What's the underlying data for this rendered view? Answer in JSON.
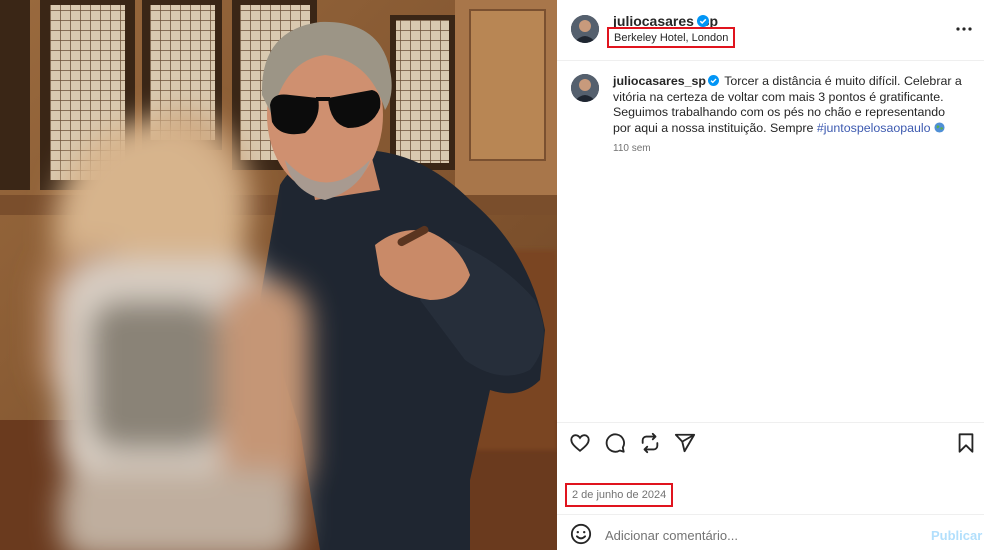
{
  "post": {
    "username": "juliocasares_sp",
    "verified_icon": "verified-badge-icon",
    "location": "Berkeley Hotel, London",
    "more_icon": "more-dots-icon",
    "caption": {
      "username": "juliocasares_sp",
      "text": "Torcer a distância é muito difícil. Celebrar a vitória na certeza de voltar com mais 3 pontos é gratificante. Seguimos trabalhando com os pés no chão e representando por aqui a nossa instituição. Sempre ",
      "hashtag": "#juntospelosaopaulo",
      "emoji": "globe-emoji"
    },
    "age": "110 sem",
    "actions": [
      "heart-icon",
      "comment-icon",
      "share-icon",
      "send-icon",
      "bookmark-icon"
    ],
    "date": "2 de junho de 2024",
    "comment": {
      "placeholder": "Adicionar comentário...",
      "publish_label": "Publicar"
    }
  },
  "colors": {
    "highlight_box": "#e0141e",
    "hashtag": "#3d5ab0",
    "verified": "#0095f6",
    "publish_disabled": "#b2dffc",
    "muted_text": "#737373"
  }
}
